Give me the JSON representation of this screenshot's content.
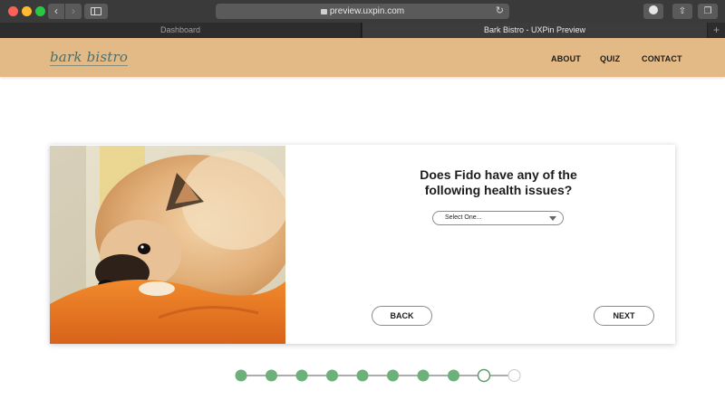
{
  "browser": {
    "url": "preview.uxpin.com",
    "tabs": [
      {
        "label": "Dashboard",
        "active": false
      },
      {
        "label": "Bark Bistro - UXPin Preview",
        "active": true
      }
    ],
    "new_tab_label": "+"
  },
  "site": {
    "logo": "bark bistro",
    "nav": [
      "ABOUT",
      "QUIZ",
      "CONTACT"
    ]
  },
  "quiz": {
    "question_line1": "Does Fido have any of the",
    "question_line2": "following health issues?",
    "select": {
      "value": "Select One..."
    },
    "back_label": "BACK",
    "next_label": "NEXT"
  },
  "progress": {
    "total_steps": 10,
    "completed_steps": 8,
    "current_step": 9,
    "colors": {
      "done": "#6db17a",
      "line": "#5a5a5a",
      "current_border": "#5d9b69",
      "upcoming_border": "#c9c9c9"
    }
  },
  "colors": {
    "header_bg": "#e3ba86",
    "logo": "#4a6f6f"
  }
}
